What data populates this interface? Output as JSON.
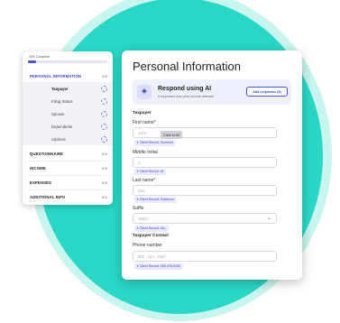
{
  "progress": {
    "label": "20% Complete",
    "fraction": 0.1
  },
  "sections": [
    {
      "label": "PERSONAL INFORMATION",
      "count": "2/5",
      "active": true
    },
    {
      "label": "QUESTIONNAIRE",
      "count": "0/3"
    },
    {
      "label": "INCOME",
      "count": "0/3"
    },
    {
      "label": "EXPENSES",
      "count": "0/3"
    },
    {
      "label": "ADDITIONAL INFO",
      "count": "0/1"
    }
  ],
  "subsections": [
    "Taxpayer",
    "Filing Status",
    "Spouse",
    "Dependents",
    "Address"
  ],
  "main": {
    "title": "Personal Information",
    "ai": {
      "title": "Respond using AI",
      "subtitle": "8 responses from prior records detected",
      "button": "Add responses (8)"
    },
    "taxpayer_heading": "Taxpayer",
    "fields": [
      {
        "label": "First name*",
        "placeholder": "John",
        "record": "Client Record: Suzanne"
      },
      {
        "label": "Middle Initial",
        "placeholder": "A",
        "record": "Client Record: M"
      },
      {
        "label": "Last name*",
        "placeholder": "Doe",
        "record": "Client Record: Robinson"
      },
      {
        "label": "Suffix",
        "placeholder": "Select",
        "record": "Client Record: Ms."
      }
    ],
    "contact_heading": "Taxpayer Contact",
    "phone": {
      "label": "Phone number",
      "placeholder": "000 - 123 - 4567",
      "record": "Client Record: 530-476-5432"
    },
    "tooltip": "Click to fill"
  }
}
